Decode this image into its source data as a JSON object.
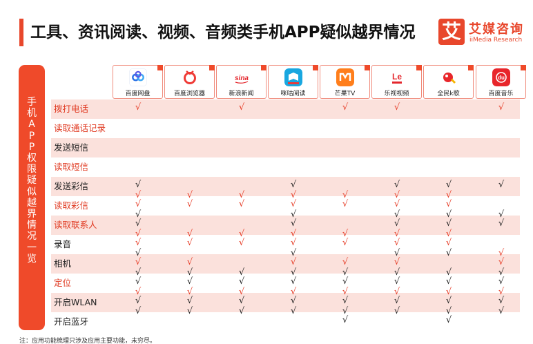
{
  "header": {
    "title": "工具、资讯阅读、视频、音频类手机APP疑似越界情况",
    "logo_mark": "艾",
    "logo_cn": "艾媒咨询",
    "logo_en": "iiMedia Research"
  },
  "left_label": "手机APP权限疑似越界情况一览",
  "apps": [
    {
      "name": "百度网盘",
      "icon": "baidu-netdisk-icon"
    },
    {
      "name": "百度浏览器",
      "icon": "baidu-browser-icon"
    },
    {
      "name": "新浪新闻",
      "icon": "sina-news-icon"
    },
    {
      "name": "咪咕阅读",
      "icon": "migu-reading-icon"
    },
    {
      "name": "芒果TV",
      "icon": "mango-tv-icon"
    },
    {
      "name": "乐视视频",
      "icon": "letv-video-icon"
    },
    {
      "name": "全民k歌",
      "icon": "quanmin-kge-icon"
    },
    {
      "name": "百度音乐",
      "icon": "baidu-music-icon"
    }
  ],
  "colors": {
    "accent": "#e8472c",
    "row_shade": "#fbe1dc",
    "check_red": "#e63a24",
    "check_black": "#222222"
  },
  "check_symbol": "√",
  "chart_data": {
    "type": "table",
    "title": "工具、资讯阅读、视频、音频类手机APP疑似越界情况",
    "columns": [
      "百度网盘",
      "百度浏览器",
      "新浪新闻",
      "咪咕阅读",
      "芒果TV",
      "乐视视频",
      "全民k歌",
      "百度音乐"
    ],
    "rows": [
      {
        "permission": "拨打电话",
        "label_color": "red",
        "marks": [
          {
            "app": "百度网盘",
            "color": "red"
          },
          {
            "app": "新浪新闻",
            "color": "red"
          },
          {
            "app": "芒果TV",
            "color": "red"
          },
          {
            "app": "乐视视频",
            "color": "red"
          },
          {
            "app": "百度音乐",
            "color": "red"
          }
        ]
      },
      {
        "permission": "读取通话记录",
        "label_color": "red",
        "marks": []
      },
      {
        "permission": "发送短信",
        "label_color": "black",
        "marks": []
      },
      {
        "permission": "读取短信",
        "label_color": "red",
        "marks": []
      },
      {
        "permission": "发送彩信",
        "label_color": "black",
        "marks": [
          {
            "app": "百度网盘",
            "color": "black"
          },
          {
            "app": "咪咕阅读",
            "color": "black"
          },
          {
            "app": "乐视视频",
            "color": "black"
          },
          {
            "app": "全民k歌",
            "color": "black"
          },
          {
            "app": "百度音乐",
            "color": "black"
          }
        ]
      },
      {
        "permission": "读取彩信",
        "label_color": "red",
        "marks": [
          {
            "app": "百度网盘",
            "color": "red"
          },
          {
            "app": "百度浏览器",
            "color": "red"
          },
          {
            "app": "新浪新闻",
            "color": "red"
          },
          {
            "app": "咪咕阅读",
            "color": "red"
          },
          {
            "app": "芒果TV",
            "color": "red"
          },
          {
            "app": "乐视视频",
            "color": "red"
          },
          {
            "app": "全民k歌",
            "color": "red"
          }
        ]
      },
      {
        "permission": "读取联系人",
        "label_color": "red",
        "marks": [
          {
            "app": "百度网盘",
            "color": "black"
          },
          {
            "app": "咪咕阅读",
            "color": "black"
          },
          {
            "app": "乐视视频",
            "color": "black"
          },
          {
            "app": "全民k歌",
            "color": "black"
          },
          {
            "app": "百度音乐",
            "color": "black"
          }
        ]
      },
      {
        "permission": "录音",
        "label_color": "black",
        "marks": [
          {
            "app": "百度网盘",
            "color": "red"
          },
          {
            "app": "百度浏览器",
            "color": "red"
          },
          {
            "app": "新浪新闻",
            "color": "red"
          },
          {
            "app": "咪咕阅读",
            "color": "red"
          },
          {
            "app": "芒果TV",
            "color": "red"
          },
          {
            "app": "乐视视频",
            "color": "red"
          },
          {
            "app": "全民k歌",
            "color": "red"
          }
        ]
      },
      {
        "permission": "相机",
        "label_color": "black",
        "marks": [
          {
            "app": "百度网盘",
            "color": "red"
          },
          {
            "app": "百度浏览器",
            "color": "red"
          },
          {
            "app": "咪咕阅读",
            "color": "red"
          },
          {
            "app": "芒果TV",
            "color": "red"
          },
          {
            "app": "乐视视频",
            "color": "red"
          },
          {
            "app": "百度音乐",
            "color": "red"
          }
        ]
      },
      {
        "permission": "定位",
        "label_color": "red",
        "marks": [
          {
            "app": "百度网盘",
            "color": "black"
          },
          {
            "app": "百度浏览器",
            "color": "black"
          },
          {
            "app": "新浪新闻",
            "color": "black"
          },
          {
            "app": "咪咕阅读",
            "color": "black"
          },
          {
            "app": "芒果TV",
            "color": "black"
          },
          {
            "app": "乐视视频",
            "color": "black"
          },
          {
            "app": "全民k歌",
            "color": "black"
          },
          {
            "app": "百度音乐",
            "color": "black"
          }
        ]
      },
      {
        "permission": "开启WLAN",
        "label_color": "black",
        "marks": [
          {
            "app": "百度网盘",
            "color": "black"
          },
          {
            "app": "百度浏览器",
            "color": "black"
          },
          {
            "app": "新浪新闻",
            "color": "black"
          },
          {
            "app": "咪咕阅读",
            "color": "black"
          },
          {
            "app": "芒果TV",
            "color": "black"
          },
          {
            "app": "乐视视频",
            "color": "black"
          },
          {
            "app": "全民k歌",
            "color": "black"
          },
          {
            "app": "百度音乐",
            "color": "black"
          }
        ]
      },
      {
        "permission": "开启蓝牙",
        "label_color": "black",
        "marks": [
          {
            "app": "芒果TV",
            "color": "black"
          },
          {
            "app": "全民k歌",
            "color": "black"
          }
        ]
      }
    ],
    "boundary_marks": [
      {
        "after_row": "拨打电话",
        "marks": []
      },
      {
        "after_row": "发送彩信",
        "marks": [
          {
            "app": "百度网盘",
            "color": "red"
          },
          {
            "app": "百度浏览器",
            "color": "red"
          },
          {
            "app": "新浪新闻",
            "color": "red"
          },
          {
            "app": "咪咕阅读",
            "color": "red"
          },
          {
            "app": "芒果TV",
            "color": "red"
          },
          {
            "app": "乐视视频",
            "color": "red"
          },
          {
            "app": "全民k歌",
            "color": "red"
          }
        ]
      },
      {
        "after_row": "读取彩信",
        "marks": [
          {
            "app": "百度网盘",
            "color": "black"
          },
          {
            "app": "咪咕阅读",
            "color": "black"
          },
          {
            "app": "乐视视频",
            "color": "black"
          },
          {
            "app": "全民k歌",
            "color": "black"
          },
          {
            "app": "百度音乐",
            "color": "black"
          }
        ]
      },
      {
        "after_row": "读取联系人",
        "marks": [
          {
            "app": "百度网盘",
            "color": "red"
          },
          {
            "app": "百度浏览器",
            "color": "red"
          },
          {
            "app": "新浪新闻",
            "color": "red"
          },
          {
            "app": "咪咕阅读",
            "color": "red"
          },
          {
            "app": "芒果TV",
            "color": "red"
          },
          {
            "app": "乐视视频",
            "color": "red"
          },
          {
            "app": "全民k歌",
            "color": "red"
          }
        ]
      },
      {
        "after_row": "录音",
        "marks": [
          {
            "app": "百度网盘",
            "color": "black"
          },
          {
            "app": "咪咕阅读",
            "color": "black"
          },
          {
            "app": "乐视视频",
            "color": "black"
          },
          {
            "app": "全民k歌",
            "color": "black"
          },
          {
            "app": "百度音乐",
            "color": "red"
          }
        ]
      },
      {
        "after_row": "相机",
        "marks": [
          {
            "app": "百度网盘",
            "color": "black"
          },
          {
            "app": "百度浏览器",
            "color": "black"
          },
          {
            "app": "新浪新闻",
            "color": "black"
          },
          {
            "app": "咪咕阅读",
            "color": "black"
          },
          {
            "app": "芒果TV",
            "color": "black"
          },
          {
            "app": "乐视视频",
            "color": "black"
          },
          {
            "app": "全民k歌",
            "color": "black"
          },
          {
            "app": "百度音乐",
            "color": "black"
          }
        ]
      },
      {
        "after_row": "定位",
        "marks": [
          {
            "app": "百度网盘",
            "color": "red"
          },
          {
            "app": "百度浏览器",
            "color": "red"
          },
          {
            "app": "新浪新闻",
            "color": "red"
          },
          {
            "app": "咪咕阅读",
            "color": "red"
          },
          {
            "app": "芒果TV",
            "color": "red"
          },
          {
            "app": "乐视视频",
            "color": "red"
          },
          {
            "app": "全民k歌",
            "color": "red"
          },
          {
            "app": "百度音乐",
            "color": "red"
          }
        ]
      },
      {
        "after_row": "开启WLAN",
        "marks": [
          {
            "app": "百度网盘",
            "color": "black"
          },
          {
            "app": "百度浏览器",
            "color": "black"
          },
          {
            "app": "新浪新闻",
            "color": "black"
          },
          {
            "app": "咪咕阅读",
            "color": "black"
          },
          {
            "app": "芒果TV",
            "color": "black"
          },
          {
            "app": "乐视视频",
            "color": "black"
          },
          {
            "app": "全民k歌",
            "color": "black"
          },
          {
            "app": "百度音乐",
            "color": "black"
          }
        ]
      }
    ]
  },
  "footnote": "注：应用功能梳理只涉及应用主要功能，未穷尽。"
}
